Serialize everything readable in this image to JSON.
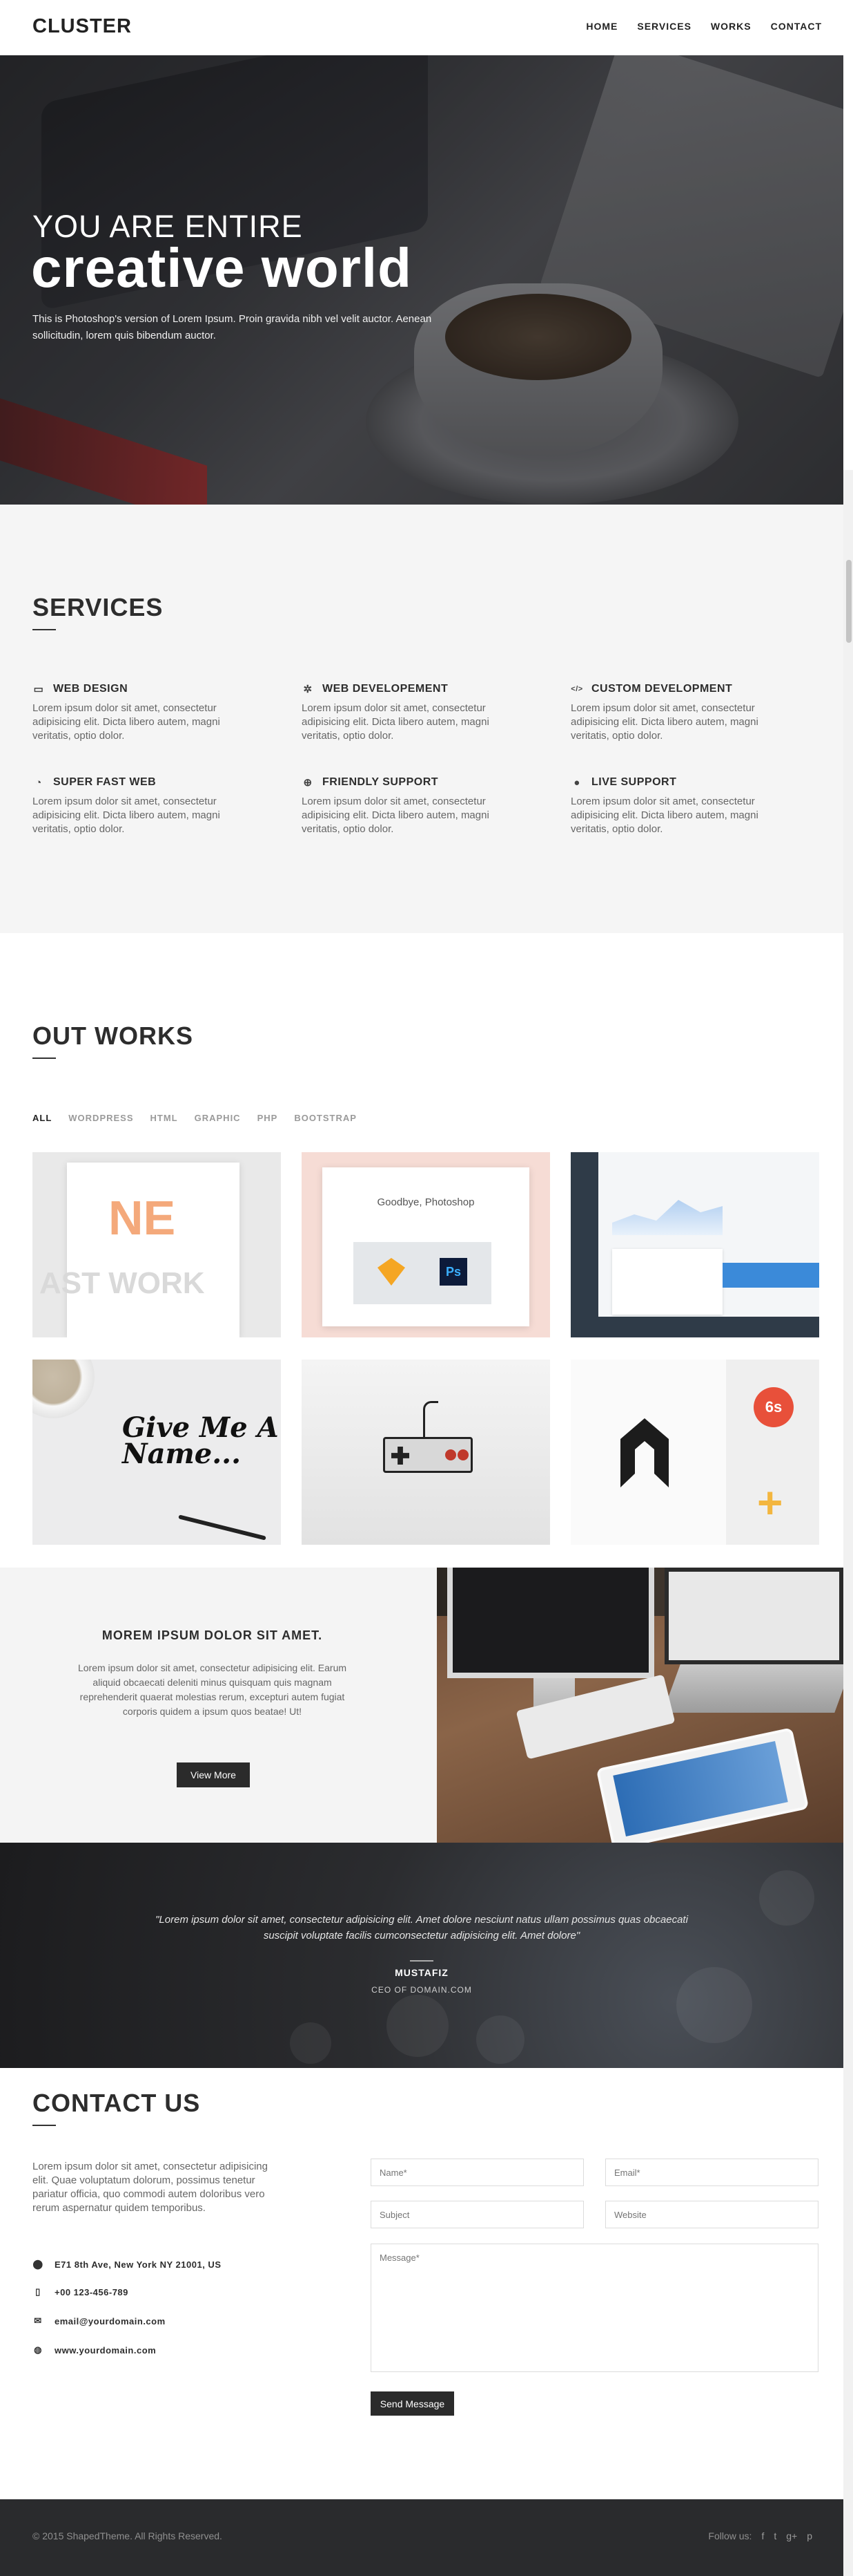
{
  "header": {
    "logo": "CLUSTER",
    "nav": [
      "HOME",
      "SERVICES",
      "WORKS",
      "CONTACT"
    ]
  },
  "hero": {
    "line1": "YOU ARE ENTIRE",
    "line2": "creative world",
    "text": "This is Photoshop's version of Lorem Ipsum. Proin gravida nibh vel velit auctor. Aenean sollicitudin, lorem quis bibendum auctor."
  },
  "services": {
    "title": "SERVICES",
    "items": [
      {
        "icon": "monitor-icon",
        "glyph": "▭",
        "title": "WEB DESIGN",
        "text": "Lorem ipsum dolor sit amet, consectetur adipisicing elit. Dicta libero autem, magni veritatis, optio dolor."
      },
      {
        "icon": "gears-icon",
        "glyph": "✲",
        "title": "WEB DEVELOPEMENT",
        "text": "Lorem ipsum dolor sit amet, consectetur adipisicing elit. Dicta libero autem, magni veritatis, optio dolor."
      },
      {
        "icon": "code-icon",
        "glyph": "</>",
        "title": "CUSTOM DEVELOPMENT",
        "text": "Lorem ipsum dolor sit amet, consectetur adipisicing elit. Dicta libero autem, magni veritatis, optio dolor."
      },
      {
        "icon": "dashboard-icon",
        "glyph": "◔",
        "title": "SUPER FAST WEB",
        "text": "Lorem ipsum dolor sit amet, consectetur adipisicing elit. Dicta libero autem, magni veritatis, optio dolor."
      },
      {
        "icon": "lifebuoy-icon",
        "glyph": "⊕",
        "title": "FRIENDLY SUPPORT",
        "text": "Lorem ipsum dolor sit amet, consectetur adipisicing elit. Dicta libero autem, magni veritatis, optio dolor."
      },
      {
        "icon": "chat-icon",
        "glyph": "●",
        "title": "LIVE SUPPORT",
        "text": "Lorem ipsum dolor sit amet, consectetur adipisicing elit. Dicta libero autem, magni veritatis, optio dolor."
      }
    ]
  },
  "works": {
    "title": "OUT WORKS",
    "filters": [
      "ALL",
      "WORDPRESS",
      "HTML",
      "GRAPHIC",
      "PHP",
      "BOOTSTRAP"
    ],
    "active_filter": "ALL",
    "tiles": {
      "t1_text": "NE",
      "t1_ghost": "AST WORK",
      "t2_text": "Goodbye, Photoshop",
      "t2_ps": "Ps",
      "t4_text": "Give Me A Name...",
      "t6_badge": "6s",
      "t6_plus": "+"
    }
  },
  "promo": {
    "title": "MOREM IPSUM DOLOR SIT AMET.",
    "text": "Lorem ipsum dolor sit amet, consectetur adipisicing elit. Earum aliquid obcaecati deleniti minus quisquam quis magnam reprehenderit quaerat molestias rerum, excepturi autem fugiat corporis quidem a ipsum quos beatae! Ut!",
    "button": "View More"
  },
  "testimonial": {
    "quote": "\"Lorem ipsum dolor sit amet, consectetur adipisicing elit. Amet dolore nesciunt natus ullam possimus quas obcaecati suscipit voluptate facilis cumconsectetur adipisicing elit. Amet dolore\"",
    "name": "MUSTAFIZ",
    "role": "CEO OF DOMAIN.COM"
  },
  "contact": {
    "title": "CONTACT US",
    "text": "Lorem ipsum dolor sit amet, consectetur adipisicing elit. Quae voluptatum dolorum, possimus tenetur pariatur officia, quo commodi autem doloribus vero rerum aspernatur quidem temporibus.",
    "address": "E71 8th Ave, New York NY 21001, US",
    "phone": "+00 123-456-789",
    "email": "email@yourdomain.com",
    "website": "www.yourdomain.com",
    "form": {
      "name_placeholder": "Name*",
      "email_placeholder": "Email*",
      "subject_placeholder": "Subject",
      "website_placeholder": "Website",
      "message_placeholder": "Message*",
      "submit": "Send Message"
    }
  },
  "footer": {
    "copyright": "© 2015 ShapedTheme. All Rights Reserved.",
    "follow": "Follow us:",
    "social": [
      {
        "icon": "facebook-icon",
        "glyph": "f"
      },
      {
        "icon": "twitter-icon",
        "glyph": "t"
      },
      {
        "icon": "google-plus-icon",
        "glyph": "g+"
      },
      {
        "icon": "pinterest-icon",
        "glyph": "p"
      }
    ]
  }
}
